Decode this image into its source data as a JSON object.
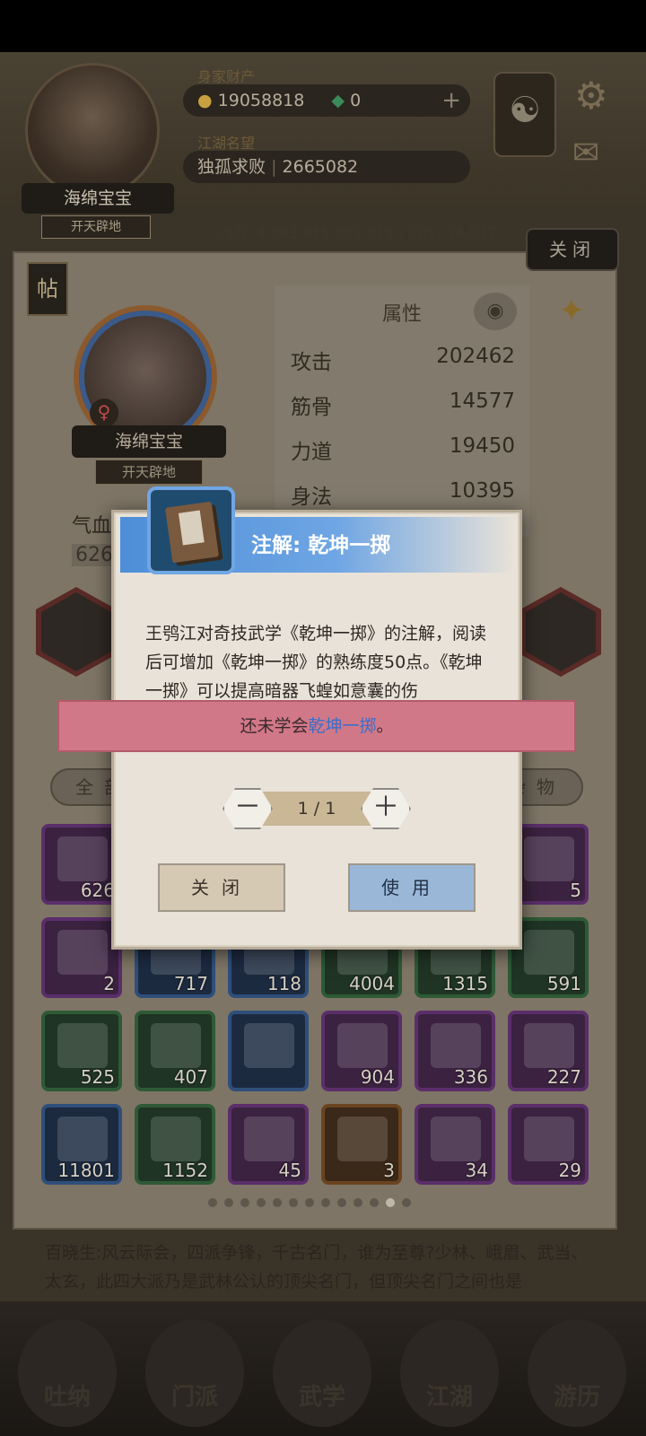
{
  "top": {
    "player_name": "海绵宝宝",
    "player_title": "开天辟地",
    "wealth_label": "身家财产",
    "gold": "19058818",
    "jade": "0",
    "reputation_label": "江湖名望",
    "reputation_rank": "独孤求败",
    "reputation_value": "2665082",
    "power_line": "内力: 4,943,915,681,019 | 悟性: 14,837"
  },
  "panel": {
    "close_label": "关闭",
    "tie_label": "帖",
    "hero_name": "海绵宝宝",
    "hero_title": "开天辟地",
    "gender_symbol": "♀",
    "attr_title": "属性",
    "attributes": [
      {
        "name": "攻击",
        "value": "202462"
      },
      {
        "name": "筋骨",
        "value": "14577"
      },
      {
        "name": "力道",
        "value": "19450"
      },
      {
        "name": "身法",
        "value": "10395"
      }
    ],
    "hp_label": "气血",
    "hp_value": "626",
    "tab_all": "全部",
    "tab_misc": "杂物"
  },
  "inventory": [
    {
      "count": "626",
      "rarity": "purple"
    },
    {
      "count": "5",
      "rarity": "purple"
    },
    {
      "count": "2",
      "rarity": "purple"
    },
    {
      "count": "717",
      "rarity": "blue"
    },
    {
      "count": "118",
      "rarity": "blue"
    },
    {
      "count": "4004",
      "rarity": "green"
    },
    {
      "count": "1315",
      "rarity": "green"
    },
    {
      "count": "591",
      "rarity": "green"
    },
    {
      "count": "525",
      "rarity": "green"
    },
    {
      "count": "407",
      "rarity": "green"
    },
    {
      "count": "",
      "rarity": "blue"
    },
    {
      "count": "904",
      "rarity": "purple"
    },
    {
      "count": "336",
      "rarity": "purple"
    },
    {
      "count": "227",
      "rarity": "purple"
    },
    {
      "count": "11801",
      "rarity": "blue"
    },
    {
      "count": "1152",
      "rarity": "green"
    },
    {
      "count": "45",
      "rarity": "purple"
    },
    {
      "count": "3",
      "rarity": "orange"
    },
    {
      "count": "34",
      "rarity": "purple"
    },
    {
      "count": "29",
      "rarity": "purple"
    }
  ],
  "pagination": {
    "total": 13,
    "current": 12
  },
  "story_text": "百晓生:风云际会，四派争锋，千古名门，谁为至尊?少林、峨眉、武当、太玄，此四大派乃是武林公认的顶尖名门，但顶尖名门之间也是",
  "nav": [
    "吐纳",
    "门派",
    "武学",
    "江湖",
    "游历"
  ],
  "dialog": {
    "title": "注解: 乾坤一掷",
    "description": "王鸮江对奇技武学《乾坤一掷》的注解，阅读后可增加《乾坤一掷》的熟练度50点。《乾坤一掷》可以提高暗器飞蝗如意囊的伤",
    "warning_prefix": "还未学会",
    "warning_skill": "乾坤一掷",
    "warning_suffix": "。",
    "quantity": "1 / 1",
    "minus": "－",
    "plus": "＋",
    "close_button": "关闭",
    "use_button": "使用"
  },
  "colors": {
    "header_blue": "#4d8ed8",
    "warning_pink": "#d17888",
    "highlight_blue": "#3c6ec8",
    "use_button": "#9ab7d8",
    "close_button": "#d6c9b4"
  }
}
